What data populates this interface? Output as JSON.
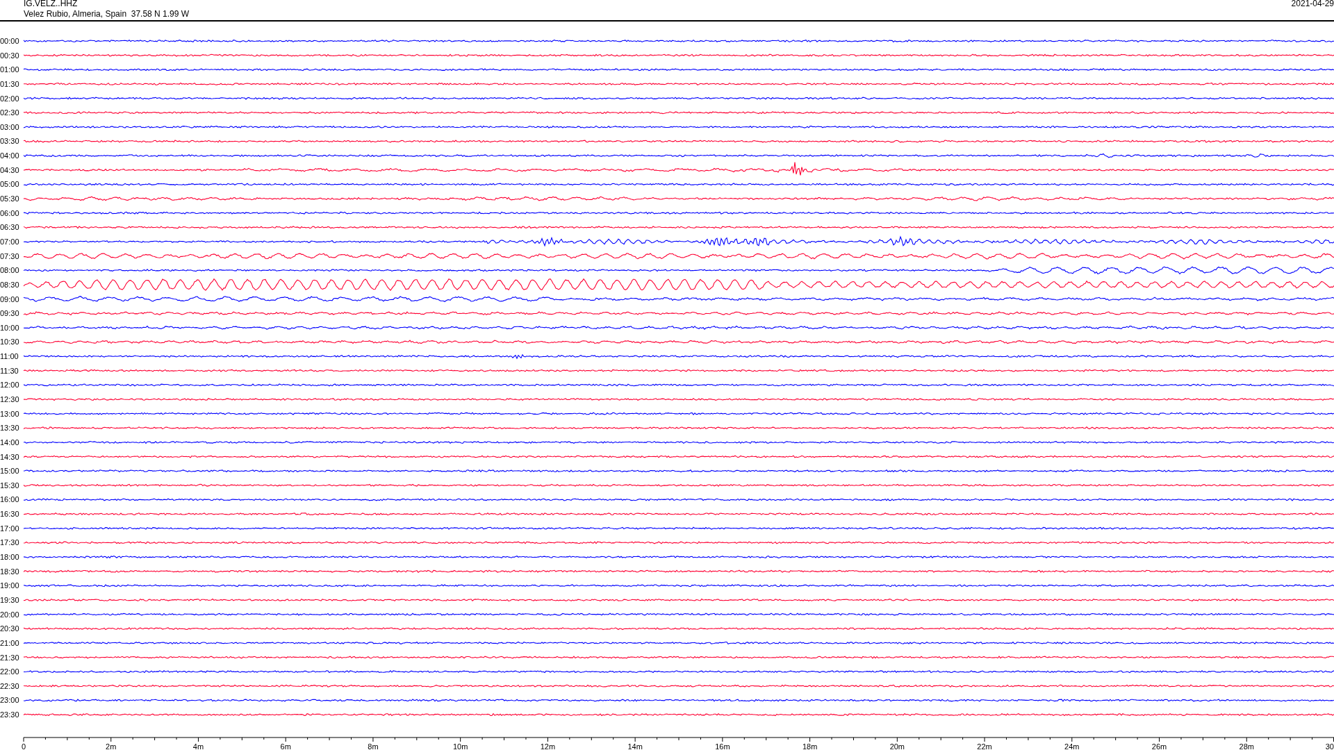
{
  "header": {
    "station": "IG.VELZ..HHZ",
    "location": "Velez Rubio, Almeria, Spain  37.58 N 1.99 W",
    "date": "2021-04-29"
  },
  "rows": [
    {
      "time": "00:00",
      "color": "#0000ff"
    },
    {
      "time": "00:30",
      "color": "#ff0033"
    },
    {
      "time": "01:00",
      "color": "#0000ff"
    },
    {
      "time": "01:30",
      "color": "#ff0033"
    },
    {
      "time": "02:00",
      "color": "#0000ff"
    },
    {
      "time": "02:30",
      "color": "#ff0033"
    },
    {
      "time": "03:00",
      "color": "#0000ff"
    },
    {
      "time": "03:30",
      "color": "#ff0033"
    },
    {
      "time": "04:00",
      "color": "#0000ff"
    },
    {
      "time": "04:30",
      "color": "#ff0033"
    },
    {
      "time": "05:00",
      "color": "#0000ff"
    },
    {
      "time": "05:30",
      "color": "#ff0033"
    },
    {
      "time": "06:00",
      "color": "#0000ff"
    },
    {
      "time": "06:30",
      "color": "#ff0033"
    },
    {
      "time": "07:00",
      "color": "#0000ff"
    },
    {
      "time": "07:30",
      "color": "#ff0033"
    },
    {
      "time": "08:00",
      "color": "#0000ff"
    },
    {
      "time": "08:30",
      "color": "#ff0033"
    },
    {
      "time": "09:00",
      "color": "#0000ff"
    },
    {
      "time": "09:30",
      "color": "#ff0033"
    },
    {
      "time": "10:00",
      "color": "#0000ff"
    },
    {
      "time": "10:30",
      "color": "#ff0033"
    },
    {
      "time": "11:00",
      "color": "#0000ff"
    },
    {
      "time": "11:30",
      "color": "#ff0033"
    },
    {
      "time": "12:00",
      "color": "#0000ff"
    },
    {
      "time": "12:30",
      "color": "#ff0033"
    },
    {
      "time": "13:00",
      "color": "#0000ff"
    },
    {
      "time": "13:30",
      "color": "#ff0033"
    },
    {
      "time": "14:00",
      "color": "#0000ff"
    },
    {
      "time": "14:30",
      "color": "#ff0033"
    },
    {
      "time": "15:00",
      "color": "#0000ff"
    },
    {
      "time": "15:30",
      "color": "#ff0033"
    },
    {
      "time": "16:00",
      "color": "#0000ff"
    },
    {
      "time": "16:30",
      "color": "#ff0033"
    },
    {
      "time": "17:00",
      "color": "#0000ff"
    },
    {
      "time": "17:30",
      "color": "#ff0033"
    },
    {
      "time": "18:00",
      "color": "#0000ff"
    },
    {
      "time": "18:30",
      "color": "#ff0033"
    },
    {
      "time": "19:00",
      "color": "#0000ff"
    },
    {
      "time": "19:30",
      "color": "#ff0033"
    },
    {
      "time": "20:00",
      "color": "#0000ff"
    },
    {
      "time": "20:30",
      "color": "#ff0033"
    },
    {
      "time": "21:00",
      "color": "#0000ff"
    },
    {
      "time": "21:30",
      "color": "#ff0033"
    },
    {
      "time": "22:00",
      "color": "#0000ff"
    },
    {
      "time": "22:30",
      "color": "#ff0033"
    },
    {
      "time": "23:00",
      "color": "#0000ff"
    },
    {
      "time": "23:30",
      "color": "#ff0033"
    }
  ],
  "time_axis": {
    "labels": [
      "0",
      "2m",
      "4m",
      "6m",
      "8m",
      "10m",
      "12m",
      "14m",
      "16m",
      "18m",
      "20m",
      "22m",
      "24m",
      "26m",
      "28m",
      "30"
    ]
  }
}
